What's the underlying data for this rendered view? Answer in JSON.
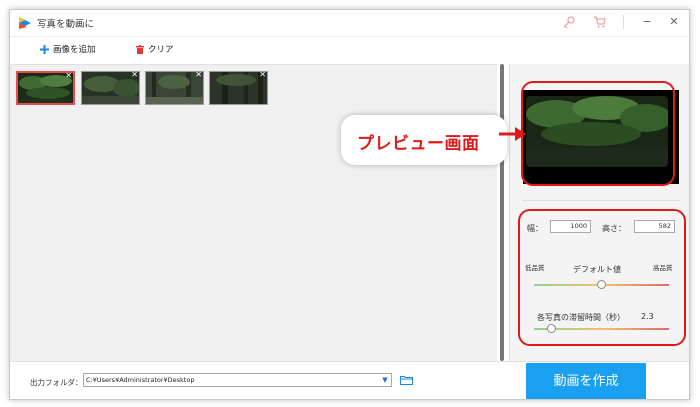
{
  "window": {
    "title": "写真を動画に"
  },
  "toolbar": {
    "add_image_label": "画像を追加",
    "clear_label": "クリア"
  },
  "thumbnails": [
    {
      "name": "photo-1",
      "selected": true
    },
    {
      "name": "photo-2",
      "selected": false
    },
    {
      "name": "photo-3",
      "selected": false
    },
    {
      "name": "photo-4",
      "selected": false
    }
  ],
  "callout": {
    "text": "プレビュー画面"
  },
  "settings": {
    "width_label": "幅：",
    "width_value": "1000",
    "height_label": "高さ：",
    "height_value": "582",
    "low_quality": "低品質",
    "high_quality": "高品質",
    "default_label": "デフォルト値",
    "duration_label": "各写真の滞留時間（秒）",
    "duration_value": "2.3",
    "quality_level": 0.5,
    "duration_level": 0.1
  },
  "output": {
    "label": "出力フォルダ：",
    "path": "C:¥Users¥Administrator¥Desktop"
  },
  "create_button": "動画を作成",
  "colors": {
    "accent": "#1aa0f0",
    "highlight": "#e01a1a"
  }
}
